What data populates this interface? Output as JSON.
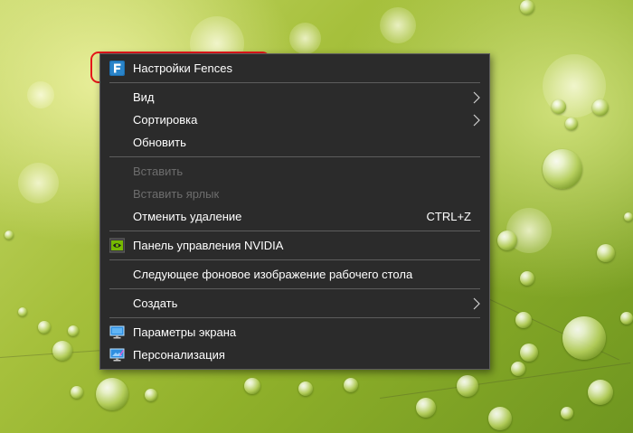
{
  "desktop": {
    "wallpaper": "green-water-drops",
    "accent_color": "#9fbb36"
  },
  "context_menu": {
    "items": [
      {
        "label": "Настройки Fences",
        "icon": "fences-icon"
      },
      {
        "label": "Вид",
        "submenu": true
      },
      {
        "label": "Сортировка",
        "submenu": true
      },
      {
        "label": "Обновить"
      },
      {
        "label": "Вставить",
        "disabled": true
      },
      {
        "label": "Вставить ярлык",
        "disabled": true
      },
      {
        "label": "Отменить удаление",
        "shortcut": "CTRL+Z"
      },
      {
        "label": "Панель управления NVIDIA",
        "icon": "nvidia-icon"
      },
      {
        "label": "Следующее фоновое изображение рабочего стола"
      },
      {
        "label": "Создать",
        "submenu": true
      },
      {
        "label": "Параметры экрана",
        "icon": "display-settings-icon"
      },
      {
        "label": "Персонализация",
        "icon": "personalization-icon"
      }
    ]
  },
  "annotation": {
    "highlight_color": "#e5161a"
  }
}
